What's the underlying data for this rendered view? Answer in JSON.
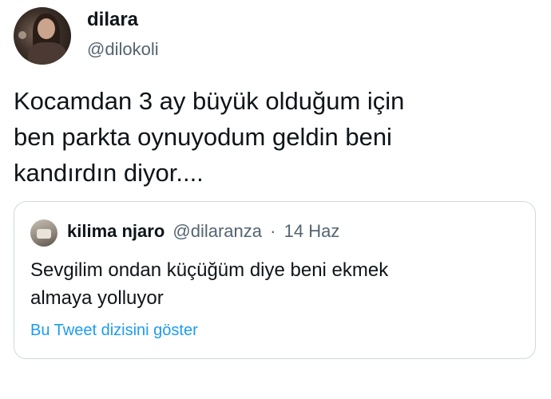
{
  "author": {
    "display_name": "dilara",
    "handle": "@dilokoli"
  },
  "tweet": {
    "text": "Kocamdan 3 ay büyük olduğum için\nben parkta oynuyodum geldin beni\nkandırdın diyor...."
  },
  "quoted_tweet": {
    "display_name": "kilima njaro",
    "handle": "@dilaranza",
    "separator": "·",
    "date": "14 Haz",
    "text": "Sevgilim ondan küçüğüm diye beni ekmek\nalmaya yolluyor",
    "show_thread_label": "Bu Tweet dizisini göster"
  },
  "colors": {
    "text_primary": "#0f1419",
    "text_secondary": "#536471",
    "link": "#1d9bf0",
    "border": "#cfd9de"
  }
}
